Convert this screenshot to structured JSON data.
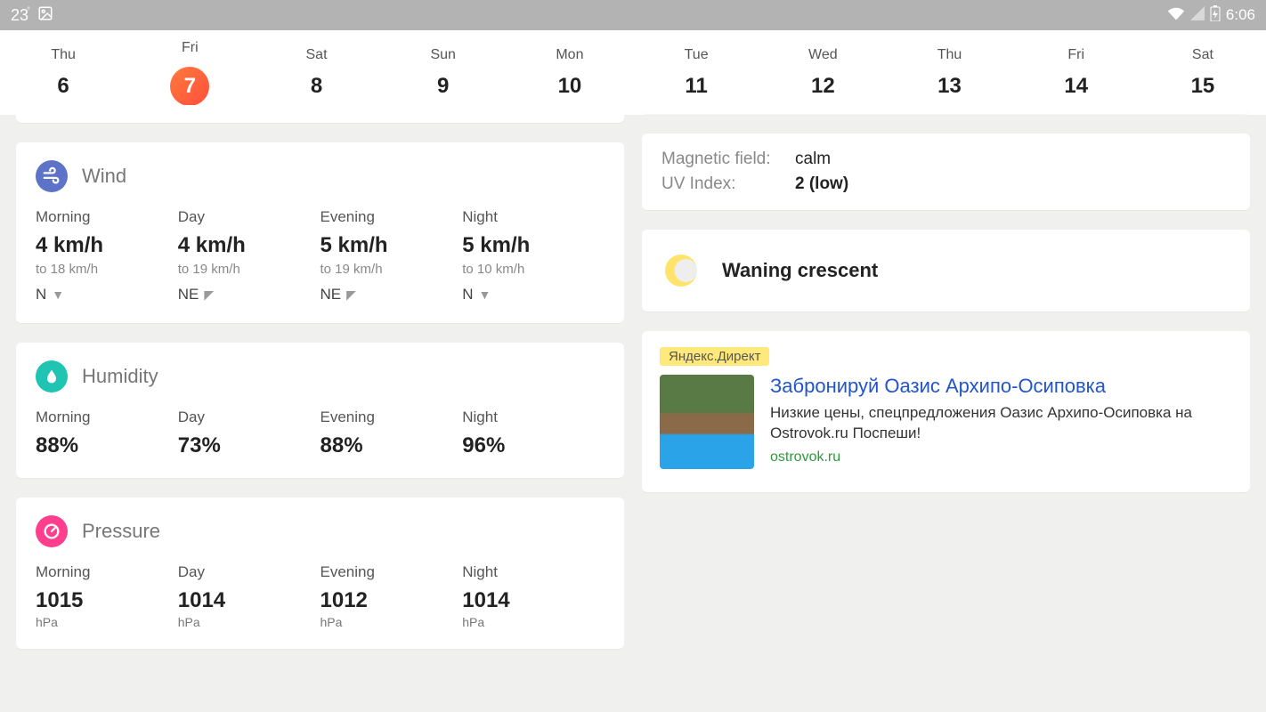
{
  "status": {
    "temp": "23",
    "degree": "°",
    "time": "6:06"
  },
  "days": [
    {
      "label": "Thu",
      "num": "6",
      "selected": false
    },
    {
      "label": "Fri",
      "num": "7",
      "selected": true
    },
    {
      "label": "Sat",
      "num": "8",
      "selected": false
    },
    {
      "label": "Sun",
      "num": "9",
      "selected": false
    },
    {
      "label": "Mon",
      "num": "10",
      "selected": false
    },
    {
      "label": "Tue",
      "num": "11",
      "selected": false
    },
    {
      "label": "Wed",
      "num": "12",
      "selected": false
    },
    {
      "label": "Thu",
      "num": "13",
      "selected": false
    },
    {
      "label": "Fri",
      "num": "14",
      "selected": false
    },
    {
      "label": "Sat",
      "num": "15",
      "selected": false
    }
  ],
  "wind": {
    "title": "Wind",
    "parts": [
      {
        "label": "Morning",
        "speed": "4 km/h",
        "gust": "to 18 km/h",
        "dir": "N",
        "arrow": "▼"
      },
      {
        "label": "Day",
        "speed": "4 km/h",
        "gust": "to 19 km/h",
        "dir": "NE",
        "arrow": "◤"
      },
      {
        "label": "Evening",
        "speed": "5 km/h",
        "gust": "to 19 km/h",
        "dir": "NE",
        "arrow": "◤"
      },
      {
        "label": "Night",
        "speed": "5 km/h",
        "gust": "to 10 km/h",
        "dir": "N",
        "arrow": "▼"
      }
    ]
  },
  "humidity": {
    "title": "Humidity",
    "parts": [
      {
        "label": "Morning",
        "value": "88%"
      },
      {
        "label": "Day",
        "value": "73%"
      },
      {
        "label": "Evening",
        "value": "88%"
      },
      {
        "label": "Night",
        "value": "96%"
      }
    ]
  },
  "pressure": {
    "title": "Pressure",
    "unit": "hPa",
    "parts": [
      {
        "label": "Morning",
        "value": "1015"
      },
      {
        "label": "Day",
        "value": "1014"
      },
      {
        "label": "Evening",
        "value": "1012"
      },
      {
        "label": "Night",
        "value": "1014"
      }
    ]
  },
  "info": {
    "magnetic_label": "Magnetic field:",
    "magnetic_value": "calm",
    "uv_label": "UV Index:",
    "uv_value": "2 (low)"
  },
  "moon": {
    "phase": "Waning crescent"
  },
  "ad": {
    "provider": "Яндекс.Директ",
    "title": "Забронируй Оазис Архипо-Осиповка",
    "desc": "Низкие цены, спецпредложения Оазис Архипо-Осиповка на Ostrovok.ru Поспеши!",
    "url": "ostrovok.ru"
  }
}
